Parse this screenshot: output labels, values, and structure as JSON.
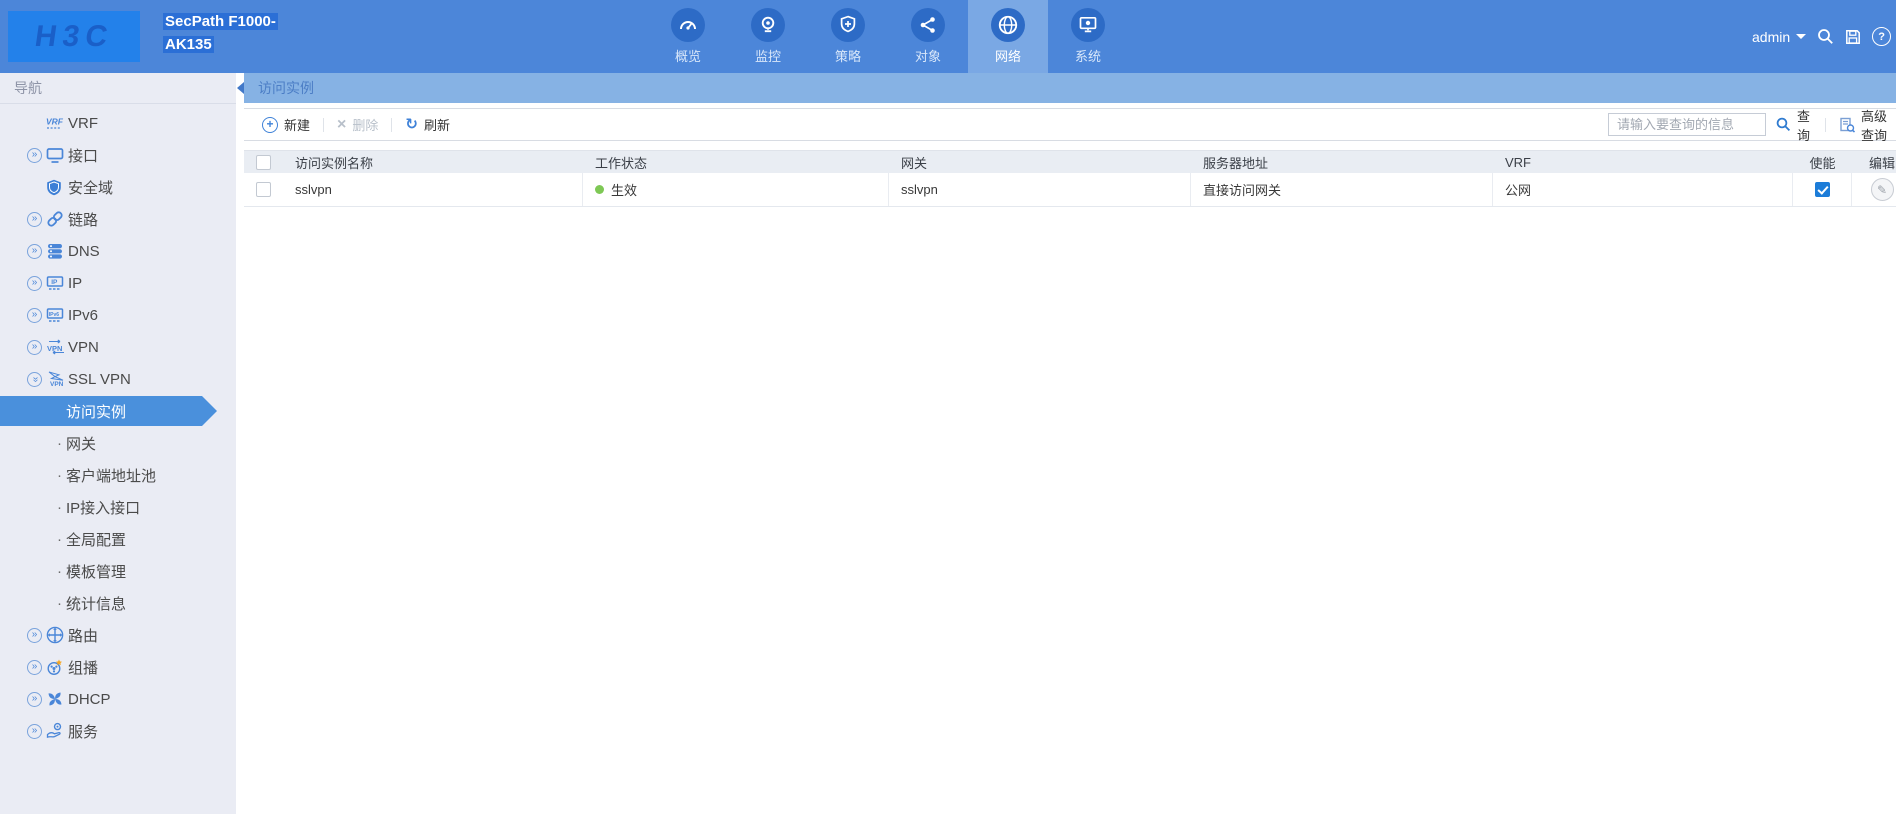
{
  "topbar": {
    "brand": "H3C",
    "device_title_lines": [
      "SecPath F1000-",
      "AK135"
    ],
    "nav_items": [
      {
        "key": "overview",
        "label": "概览",
        "icon": "gauge-icon",
        "active": false
      },
      {
        "key": "monitoring",
        "label": "监控",
        "icon": "monitor-camera-icon",
        "active": false
      },
      {
        "key": "policies",
        "label": "策略",
        "icon": "shield-plus-icon",
        "active": false
      },
      {
        "key": "objects",
        "label": "对象",
        "icon": "share-icon",
        "active": false
      },
      {
        "key": "network",
        "label": "网络",
        "icon": "globe-icon",
        "active": true
      },
      {
        "key": "system",
        "label": "系统",
        "icon": "system-monitor-icon",
        "active": false
      }
    ],
    "user": "admin"
  },
  "sidebar": {
    "title": "导航",
    "items": [
      {
        "key": "vrf",
        "label": "VRF",
        "icon": "vrf-icon",
        "expandable": false
      },
      {
        "key": "interface",
        "label": "接口",
        "icon": "interface-icon",
        "expandable": true
      },
      {
        "key": "security-zone",
        "label": "安全域",
        "icon": "shield-icon",
        "expandable": false
      },
      {
        "key": "link",
        "label": "链路",
        "icon": "link-icon",
        "expandable": true
      },
      {
        "key": "dns",
        "label": "DNS",
        "icon": "dns-icon",
        "expandable": true
      },
      {
        "key": "ip",
        "label": "IP",
        "icon": "ip-icon",
        "expandable": true
      },
      {
        "key": "ipv6",
        "label": "IPv6",
        "icon": "ipv6-icon",
        "expandable": true
      },
      {
        "key": "vpn",
        "label": "VPN",
        "icon": "vpn-icon",
        "expandable": true
      },
      {
        "key": "ssl-vpn",
        "label": "SSL VPN",
        "icon": "sslvpn-icon",
        "expandable": true,
        "expanded": true,
        "children": [
          {
            "key": "access-instance",
            "label": "访问实例",
            "selected": true
          },
          {
            "key": "gateway",
            "label": "网关",
            "selected": false
          },
          {
            "key": "client-address-pool",
            "label": "客户端地址池",
            "selected": false
          },
          {
            "key": "ip-access-interface",
            "label": "IP接入接口",
            "selected": false
          },
          {
            "key": "global-config",
            "label": "全局配置",
            "selected": false
          },
          {
            "key": "template-management",
            "label": "模板管理",
            "selected": false
          },
          {
            "key": "statistics",
            "label": "统计信息",
            "selected": false
          }
        ]
      },
      {
        "key": "route",
        "label": "路由",
        "icon": "route-icon",
        "expandable": true
      },
      {
        "key": "multicast",
        "label": "组播",
        "icon": "multicast-icon",
        "expandable": true
      },
      {
        "key": "dhcp",
        "label": "DHCP",
        "icon": "dhcp-icon",
        "expandable": true
      },
      {
        "key": "service",
        "label": "服务",
        "icon": "service-icon",
        "expandable": true
      }
    ]
  },
  "breadcrumb": "访问实例",
  "toolbar": {
    "new": "新建",
    "delete": "删除",
    "refresh": "刷新",
    "search_placeholder": "请输入要查询的信息",
    "query": "查询",
    "advanced_query": "高级查询"
  },
  "table": {
    "columns": [
      "访问实例名称",
      "工作状态",
      "网关",
      "服务器地址",
      "VRF",
      "使能",
      "编辑"
    ],
    "rows": [
      {
        "name": "sslvpn",
        "status": "生效",
        "gateway": "sslvpn",
        "server_address": "直接访问网关",
        "vrf": "公网",
        "enabled": true
      }
    ]
  },
  "colors": {
    "topbar_blue": "#4c86d9",
    "active_tab_blue": "#7aa8e4",
    "selected_item_blue": "#4a90dc",
    "status_active_green": "#7ec855",
    "checkbox_checked_blue": "#1c7cd8"
  }
}
